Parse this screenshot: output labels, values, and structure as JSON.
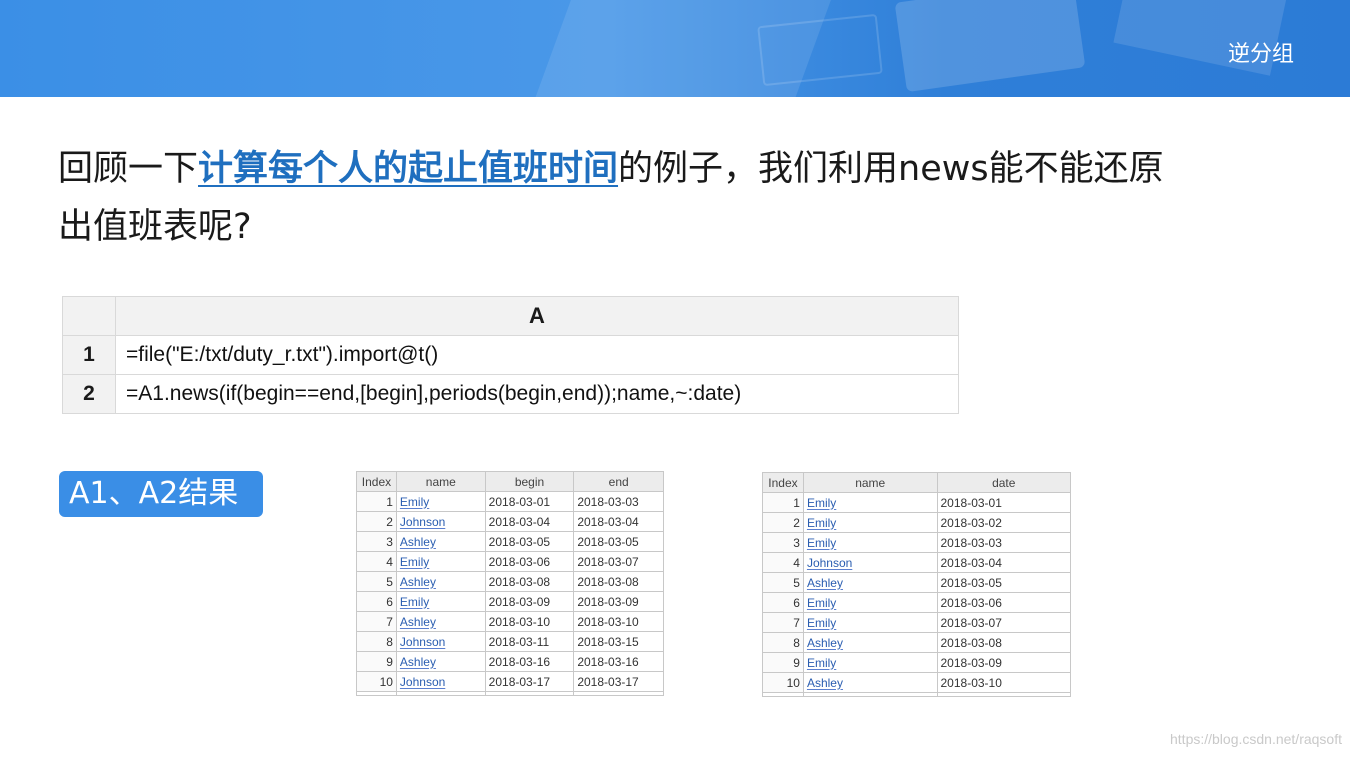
{
  "header": {
    "title": "逆分组"
  },
  "question": {
    "prefix": "回顾一下",
    "link_text": "计算每个人的起止值班时间",
    "line1_suffix": "的例子，我们利用news能不能还原",
    "line2": "出值班表呢?"
  },
  "code_grid": {
    "column_header": "A",
    "rows": [
      {
        "num": "1",
        "code": "=file(\"E:/txt/duty_r.txt\").import@t()"
      },
      {
        "num": "2",
        "code": "=A1.news(if(begin==end,[begin],periods(begin,end));name,~:date)"
      }
    ]
  },
  "badge": {
    "label": "A1、A2结果"
  },
  "table_a1": {
    "headers": [
      "Index",
      "name",
      "begin",
      "end"
    ],
    "rows": [
      [
        "1",
        "Emily",
        "2018-03-01",
        "2018-03-03"
      ],
      [
        "2",
        "Johnson",
        "2018-03-04",
        "2018-03-04"
      ],
      [
        "3",
        "Ashley",
        "2018-03-05",
        "2018-03-05"
      ],
      [
        "4",
        "Emily",
        "2018-03-06",
        "2018-03-07"
      ],
      [
        "5",
        "Ashley",
        "2018-03-08",
        "2018-03-08"
      ],
      [
        "6",
        "Emily",
        "2018-03-09",
        "2018-03-09"
      ],
      [
        "7",
        "Ashley",
        "2018-03-10",
        "2018-03-10"
      ],
      [
        "8",
        "Johnson",
        "2018-03-11",
        "2018-03-15"
      ],
      [
        "9",
        "Ashley",
        "2018-03-16",
        "2018-03-16"
      ],
      [
        "10",
        "Johnson",
        "2018-03-17",
        "2018-03-17"
      ]
    ]
  },
  "table_a2": {
    "headers": [
      "Index",
      "name",
      "date"
    ],
    "rows": [
      [
        "1",
        "Emily",
        "2018-03-01"
      ],
      [
        "2",
        "Emily",
        "2018-03-02"
      ],
      [
        "3",
        "Emily",
        "2018-03-03"
      ],
      [
        "4",
        "Johnson",
        "2018-03-04"
      ],
      [
        "5",
        "Ashley",
        "2018-03-05"
      ],
      [
        "6",
        "Emily",
        "2018-03-06"
      ],
      [
        "7",
        "Emily",
        "2018-03-07"
      ],
      [
        "8",
        "Ashley",
        "2018-03-08"
      ],
      [
        "9",
        "Emily",
        "2018-03-09"
      ],
      [
        "10",
        "Ashley",
        "2018-03-10"
      ]
    ]
  },
  "watermark": "https://blog.csdn.net/raqsoft"
}
